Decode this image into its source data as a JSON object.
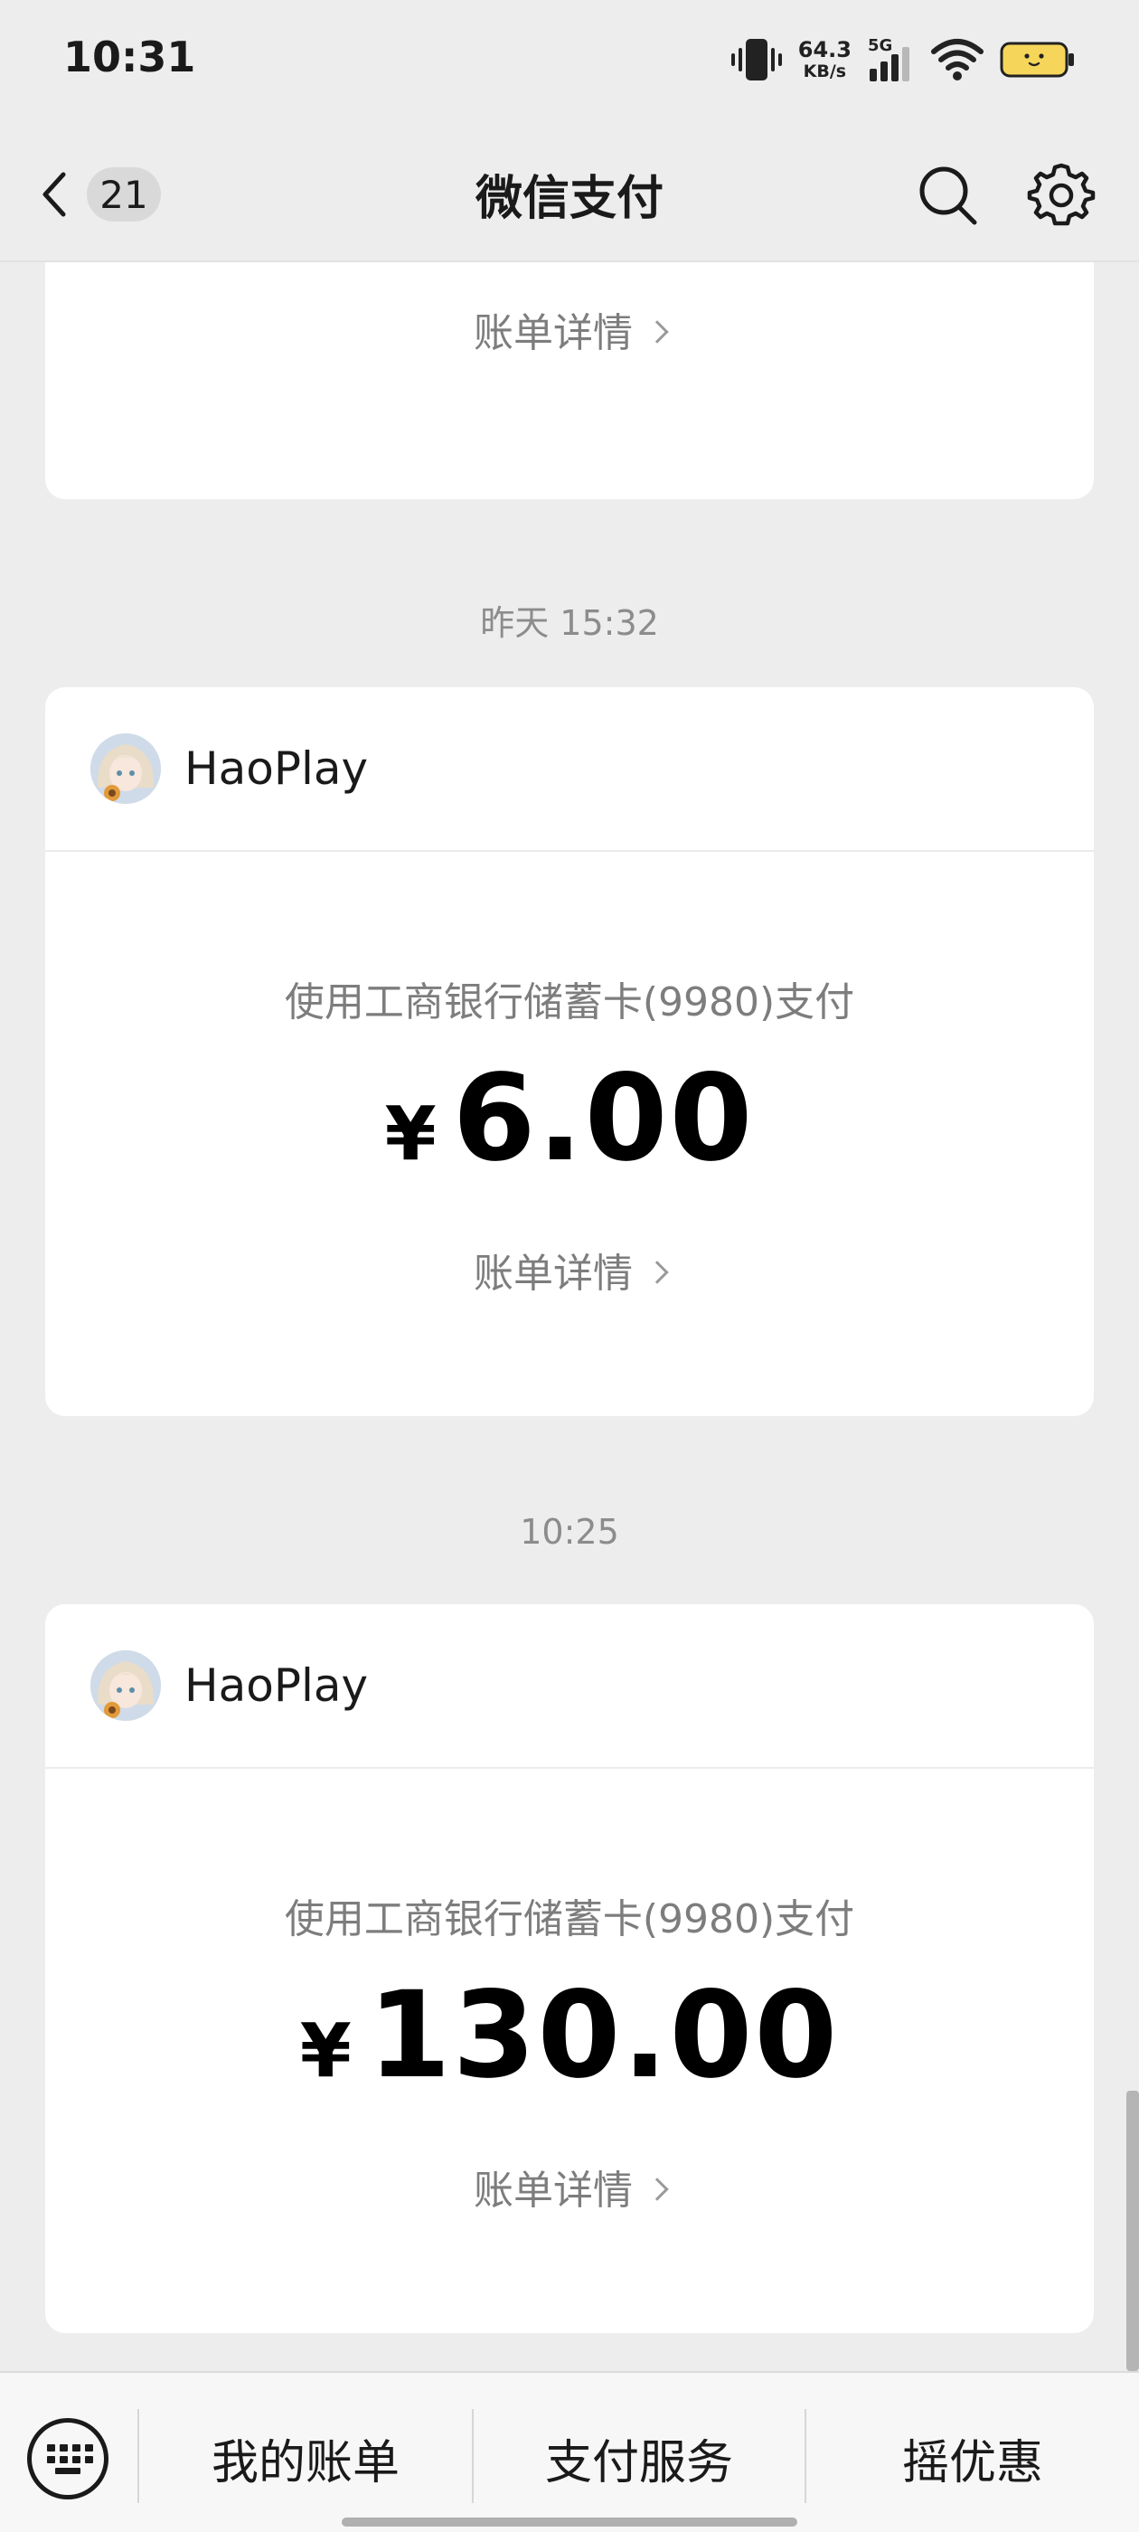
{
  "status_bar": {
    "time": "10:31",
    "net_speed_value": "64.3",
    "net_speed_unit": "KB/s",
    "network_type": "5G",
    "icons": [
      "vibrate-icon",
      "signal-icon",
      "wifi-icon",
      "battery-icon"
    ]
  },
  "header": {
    "title": "微信支付",
    "back_badge": "21",
    "icons": [
      "back-icon",
      "search-icon",
      "settings-icon"
    ]
  },
  "feed": {
    "partial_card": {
      "detail_label": "账单详情"
    },
    "messages": [
      {
        "timestamp": "昨天 15:32",
        "merchant": "HaoPlay",
        "pay_method": "使用工商银行储蓄卡(9980)支付",
        "currency": "¥",
        "amount": "6.00",
        "detail_label": "账单详情"
      },
      {
        "timestamp": "10:25",
        "merchant": "HaoPlay",
        "pay_method": "使用工商银行储蓄卡(9980)支付",
        "currency": "¥",
        "amount": "130.00",
        "detail_label": "账单详情"
      }
    ]
  },
  "bottom_menu": {
    "keyboard_icon": "keyboard-icon",
    "items": [
      "我的账单",
      "支付服务",
      "摇优惠"
    ]
  },
  "colors": {
    "background": "#ededed",
    "card": "#ffffff",
    "battery": "#f6d65a"
  }
}
